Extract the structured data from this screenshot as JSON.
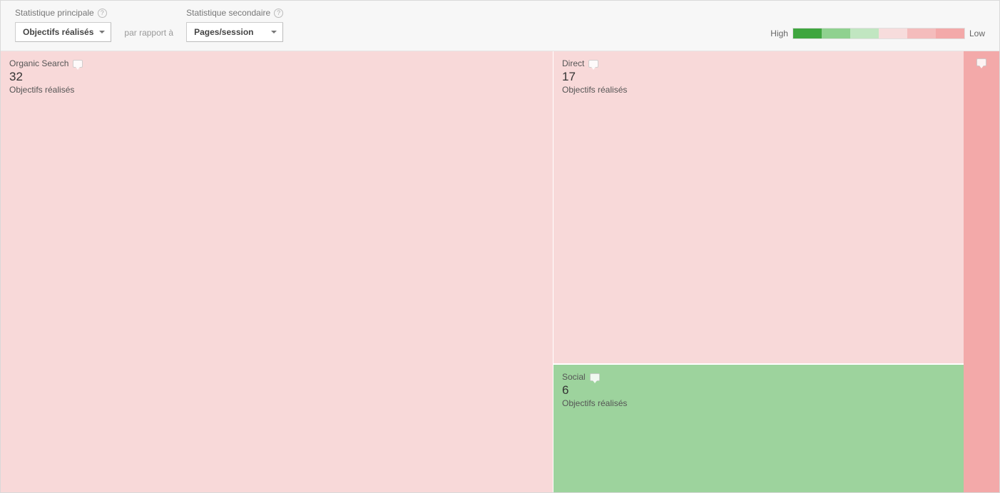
{
  "toolbar": {
    "primary_label": "Statistique principale",
    "primary_value": "Objectifs réalisés",
    "compare_label": "par rapport à",
    "secondary_label": "Statistique secondaire",
    "secondary_value": "Pages/session"
  },
  "legend": {
    "high_label": "High",
    "low_label": "Low",
    "colors": [
      "#3fa63f",
      "#8fd18f",
      "#c1e6c1",
      "#f7dcdc",
      "#f4bcbc",
      "#f3a9a9"
    ]
  },
  "cells": {
    "organic": {
      "title": "Organic Search",
      "value": "32",
      "sub": "Objectifs réalisés",
      "bg": "#f8d9d9"
    },
    "direct": {
      "title": "Direct",
      "value": "17",
      "sub": "Objectifs réalisés",
      "bg": "#f8d9d9"
    },
    "social": {
      "title": "Social",
      "value": "6",
      "sub": "Objectifs réalisés",
      "bg": "#9dd39d"
    },
    "other": {
      "bg": "#f3a9a9"
    }
  },
  "chart_data": {
    "type": "treemap",
    "primary_metric": "Objectifs réalisés",
    "secondary_metric": "Pages/session",
    "color_scale": {
      "high": "#3fa63f",
      "low": "#f3a9a9"
    },
    "items": [
      {
        "name": "Organic Search",
        "value": 32,
        "color_level": "low"
      },
      {
        "name": "Direct",
        "value": 17,
        "color_level": "low"
      },
      {
        "name": "Social",
        "value": 6,
        "color_level": "high"
      }
    ]
  }
}
